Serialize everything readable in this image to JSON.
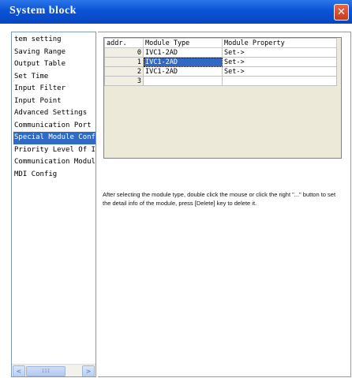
{
  "window": {
    "title": "System block",
    "close_glyph": "✕"
  },
  "sidebar": {
    "items": [
      {
        "label": "tem setting",
        "selected": false
      },
      {
        "label": "Saving Range",
        "selected": false
      },
      {
        "label": "Output Table",
        "selected": false
      },
      {
        "label": "Set Time",
        "selected": false
      },
      {
        "label": "Input Filter",
        "selected": false
      },
      {
        "label": "Input Point",
        "selected": false
      },
      {
        "label": "Advanced Settings",
        "selected": false
      },
      {
        "label": "Communication Port",
        "selected": false
      },
      {
        "label": "Special Module Configu",
        "selected": true
      },
      {
        "label": "Priority Level Of Inte",
        "selected": false
      },
      {
        "label": "Communication Modules",
        "selected": false
      },
      {
        "label": "MDI Config",
        "selected": false
      }
    ],
    "scrollbar": {
      "left_glyph": "<",
      "right_glyph": ">",
      "thumb_glyph": "III"
    }
  },
  "table": {
    "headers": [
      "addr.",
      "Module Type",
      "Module Property"
    ],
    "rows": [
      {
        "addr": "0",
        "type": "IVC1-2AD",
        "property": "Set->",
        "selected": false
      },
      {
        "addr": "1",
        "type": "IVC1-2AD",
        "property": "Set->",
        "selected": true
      },
      {
        "addr": "2",
        "type": "IVC1-2AD",
        "property": "Set->",
        "selected": false
      },
      {
        "addr": "3",
        "type": "",
        "property": "",
        "selected": false
      }
    ]
  },
  "help_text": "After selecting the module type, double click the mouse or click the right \"...\" button to set the detail info of the module, press [Delete] key to delete it.",
  "colors": {
    "title_bar": "#0a53d6",
    "selection": "#316ac5",
    "grid_background": "#ece9d8"
  }
}
